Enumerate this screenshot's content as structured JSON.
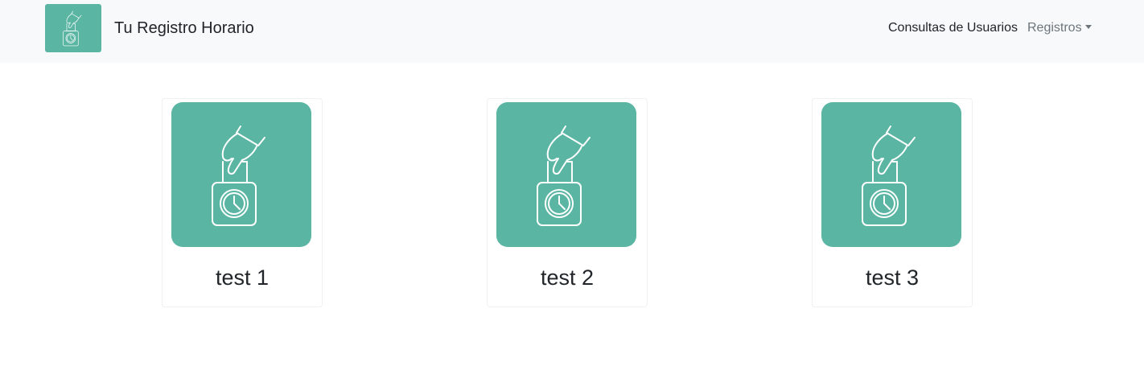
{
  "navbar": {
    "brand_name": "Tu Registro Horario",
    "links": [
      {
        "label": "Consultas de Usuarios"
      },
      {
        "label": "Registros"
      }
    ]
  },
  "cards": [
    {
      "title": "test 1"
    },
    {
      "title": "test 2"
    },
    {
      "title": "test 3"
    }
  ],
  "colors": {
    "accent": "#5ab5a3",
    "navbar_bg": "#f8f9fa",
    "text": "#212529",
    "muted": "#6c757d"
  },
  "icons": {
    "logo": "time-clock-punch-icon",
    "card_image": "time-clock-punch-icon"
  }
}
